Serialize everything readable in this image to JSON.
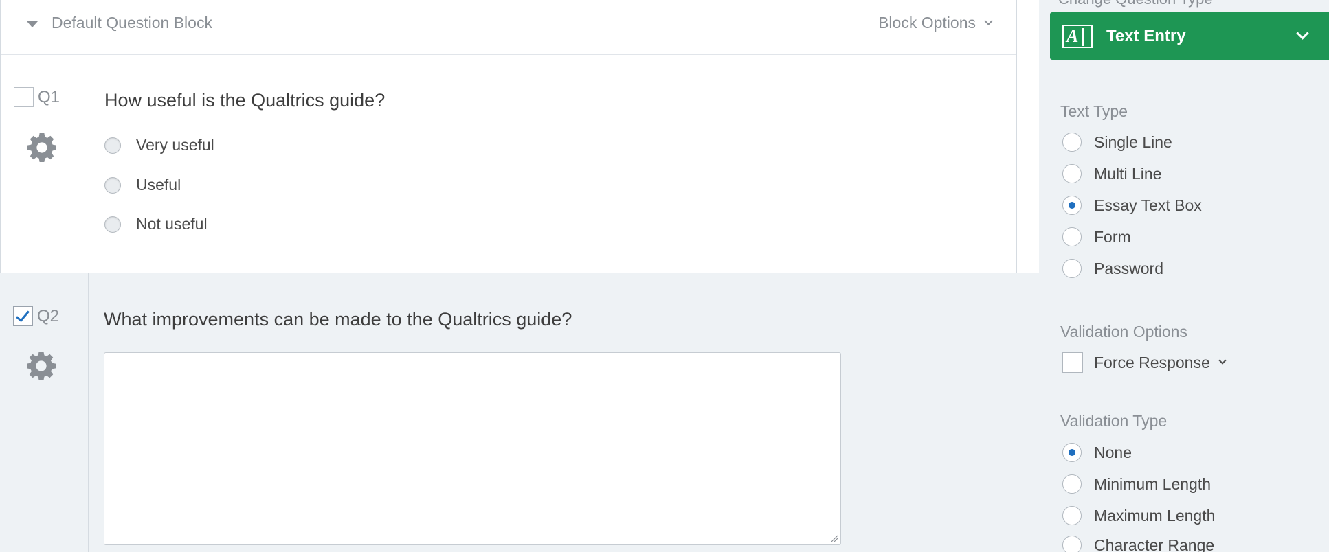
{
  "block": {
    "title": "Default Question Block",
    "options_label": "Block Options"
  },
  "q1": {
    "number": "Q1",
    "selected": false,
    "text": "How useful is the Qualtrics guide?",
    "choices": [
      "Very useful",
      "Useful",
      "Not useful"
    ]
  },
  "q2": {
    "number": "Q2",
    "selected": true,
    "text": "What improvements can be made to the Qualtrics guide?",
    "answer": ""
  },
  "panel": {
    "cut_heading": "Change Question Type",
    "question_type": "Text Entry",
    "question_type_color": "#1e9654",
    "text_type": {
      "label": "Text Type",
      "options": [
        "Single Line",
        "Multi Line",
        "Essay Text Box",
        "Form",
        "Password"
      ],
      "selected": "Essay Text Box"
    },
    "validation_options": {
      "label": "Validation Options",
      "force_response": "Force Response"
    },
    "validation_type": {
      "label": "Validation Type",
      "options": [
        "None",
        "Minimum Length",
        "Maximum Length",
        "Character Range"
      ],
      "selected": "None"
    }
  }
}
